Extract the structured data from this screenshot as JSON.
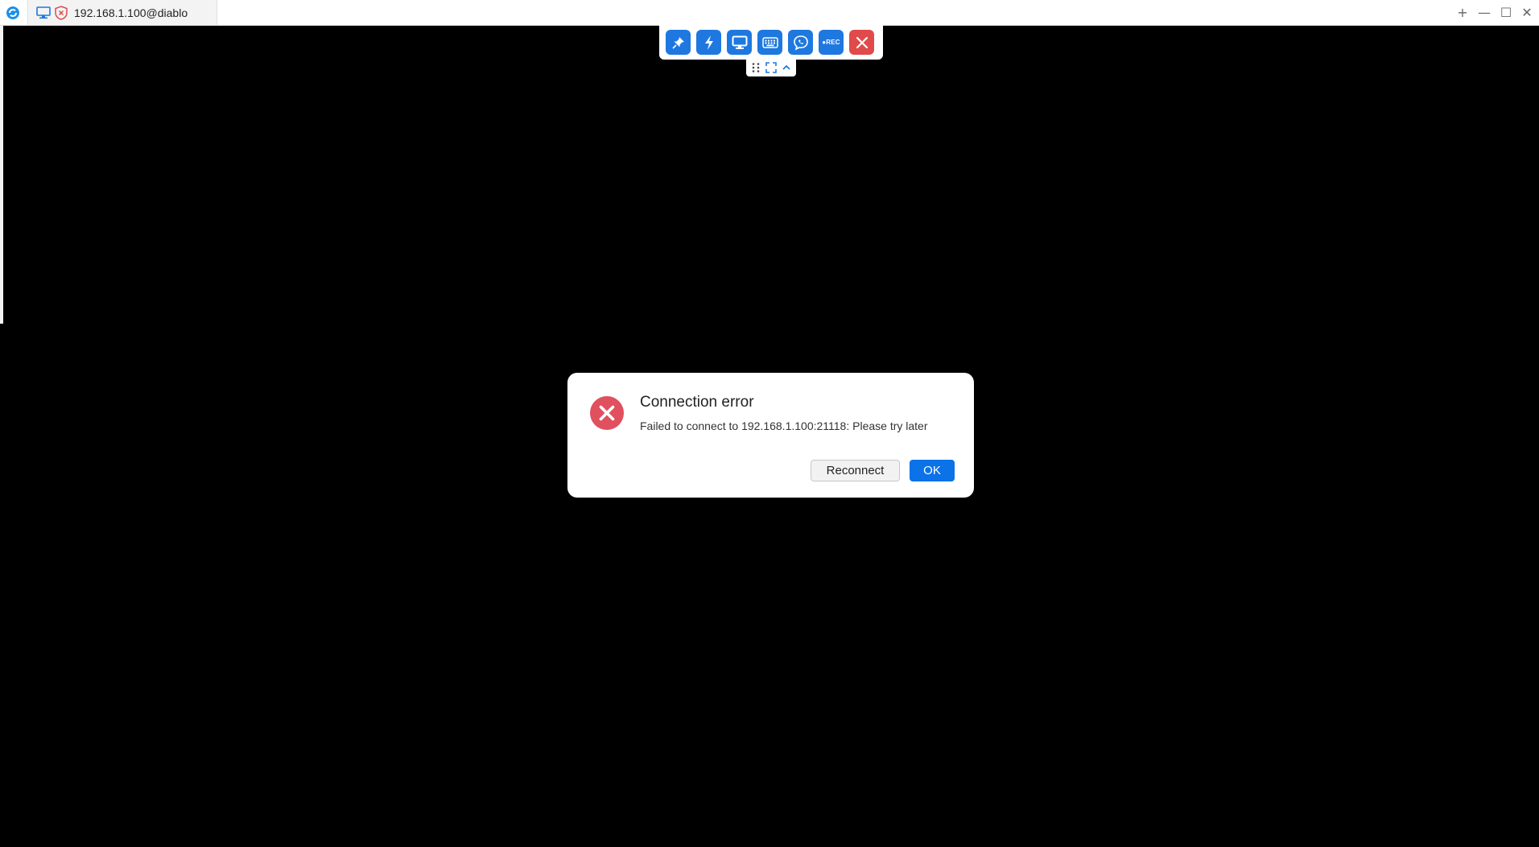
{
  "window": {
    "tab_title": "192.168.1.100@diablo",
    "controls": {
      "add": "+",
      "minimize": "—",
      "maximize": "☐",
      "close": "✕"
    }
  },
  "toolbar": {
    "buttons": [
      {
        "name": "pin",
        "icon": "pin-icon"
      },
      {
        "name": "actions",
        "icon": "lightning-icon"
      },
      {
        "name": "display",
        "icon": "monitor-icon"
      },
      {
        "name": "keyboard",
        "icon": "keyboard-icon"
      },
      {
        "name": "chat",
        "icon": "chat-icon"
      },
      {
        "name": "record",
        "icon": "record-icon",
        "label": "●REC"
      },
      {
        "name": "close-session",
        "icon": "close-icon"
      }
    ],
    "sub_icons": [
      "drag-handle-icon",
      "fullscreen-icon",
      "collapse-chevron-icon"
    ]
  },
  "dialog": {
    "title": "Connection error",
    "message": "Failed to connect to 192.168.1.100:21118: Please try later",
    "reconnect_label": "Reconnect",
    "ok_label": "OK"
  },
  "colors": {
    "accent": "#1e78e0",
    "danger": "#e04a4a",
    "ok_button": "#0b72e7",
    "error_icon": "#e0505f",
    "background": "#000000"
  }
}
